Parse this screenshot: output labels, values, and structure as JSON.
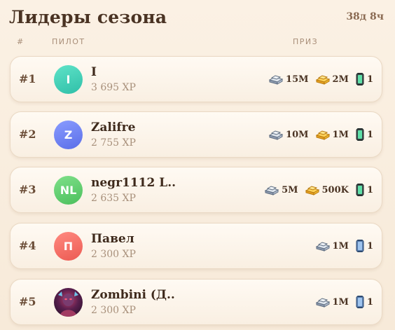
{
  "title": "Лидеры сезона",
  "timer": "38д 8ч",
  "columns": {
    "rank": "#",
    "pilot": "ПИЛОТ",
    "prize": "ПРИЗ"
  },
  "leaders": [
    {
      "rank": "#1",
      "avatar_letter": "I",
      "avatar_color": "#3fd1b8",
      "name": "I",
      "xp": "3 695 XP",
      "prizes": [
        {
          "icon": "steel-icon",
          "value": "15M"
        },
        {
          "icon": "gold-icon",
          "value": "2M"
        },
        {
          "icon": "green-canister-icon",
          "value": "1"
        }
      ]
    },
    {
      "rank": "#2",
      "avatar_letter": "Z",
      "avatar_color": "#6a80f2",
      "name": "Zalifre",
      "xp": "2 755 XP",
      "prizes": [
        {
          "icon": "steel-icon",
          "value": "10M"
        },
        {
          "icon": "gold-icon",
          "value": "1M"
        },
        {
          "icon": "green-canister-icon",
          "value": "1"
        }
      ]
    },
    {
      "rank": "#3",
      "avatar_letter": "NL",
      "avatar_color": "#62cf6e",
      "name": "negr1112 L..",
      "xp": "2 635 XP",
      "prizes": [
        {
          "icon": "steel-icon",
          "value": "5M"
        },
        {
          "icon": "gold-icon",
          "value": "500K"
        },
        {
          "icon": "green-canister-icon",
          "value": "1"
        }
      ]
    },
    {
      "rank": "#4",
      "avatar_letter": "П",
      "avatar_color": "#f2645e",
      "name": "Павел",
      "xp": "2 300 XP",
      "prizes": [
        {
          "icon": "steel-icon",
          "value": "1M"
        },
        {
          "icon": "blue-canister-icon",
          "value": "1"
        }
      ]
    },
    {
      "rank": "#5",
      "avatar_letter": "",
      "avatar_color": "#3a1f3d",
      "name": "Zombini (Д..",
      "xp": "2 300 XP",
      "prizes": [
        {
          "icon": "steel-icon",
          "value": "1M"
        },
        {
          "icon": "blue-canister-icon",
          "value": "1"
        }
      ]
    }
  ]
}
